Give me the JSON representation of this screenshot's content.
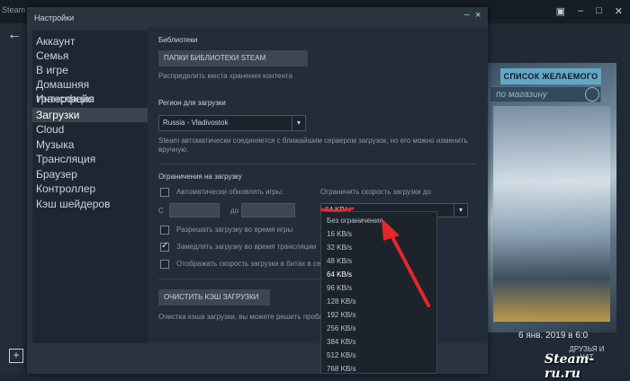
{
  "background": {
    "app_title": "Steam",
    "wishlist_button": "СПИСОК ЖЕЛАЕМОГО",
    "store_search_placeholder": "по магазину",
    "date_text": "6 янв. 2019 в 6:0",
    "friends_label": "ДРУЗЬЯ И ЧАТ",
    "watermark": "Steam-ru.ru"
  },
  "dialog": {
    "title": "Настройки",
    "close_icon": "×",
    "minimize_icon": "–"
  },
  "sidebar": {
    "items": [
      {
        "label": "Аккаунт"
      },
      {
        "label": "Семья"
      },
      {
        "label": "В игре"
      },
      {
        "label": "Домашняя трансляция"
      },
      {
        "label": "Интерфейс"
      },
      {
        "label": "Загрузки",
        "active": true
      },
      {
        "label": "Cloud"
      },
      {
        "label": "Музыка"
      },
      {
        "label": "Трансляция"
      },
      {
        "label": "Браузер"
      },
      {
        "label": "Контроллер"
      },
      {
        "label": "Кэш шейдеров"
      }
    ]
  },
  "libraries": {
    "heading": "Библиотеки",
    "button": "ПАПКИ БИБЛИОТЕКИ STEAM",
    "description": "Распределить места хранения контента"
  },
  "region": {
    "heading": "Регион для загрузки",
    "selected": "Russia - Vladivostok",
    "note_line1": "Steam автоматически соединяется с ближайшим сервером загрузок, но его можно изменить",
    "note_line2": "вручную."
  },
  "limits": {
    "heading": "Ограничения на загрузку",
    "auto_update_label": "Автоматически обновлять игры:",
    "from_label": "С",
    "to_label": "до",
    "speed_limit_label": "Ограничить скорость загрузки до",
    "speed_selected": "64 KB/s",
    "allow_during_games": "Разрешать загрузку во время игры",
    "throttle_during_broadcast": "Замедлять загрузку во время трансляции",
    "show_bits": "Отображать скорость загрузки в битах в секу"
  },
  "cache": {
    "button": "ОЧИСТИТЬ КЭШ ЗАГРУЗКИ",
    "description": "Очистка кэша загрузки, вы можете решить проблем"
  },
  "speed_options": [
    "Без ограничения",
    "16 KB/s",
    "32 KB/s",
    "48 KB/s",
    "64 KB/s",
    "96 KB/s",
    "128 KB/s",
    "192 KB/s",
    "256 KB/s",
    "384 KB/s",
    "512 KB/s",
    "768 KB/s"
  ],
  "accent_colors": {
    "annotation_arrow": "#e8262a",
    "wishlist": "#63a7c4"
  }
}
